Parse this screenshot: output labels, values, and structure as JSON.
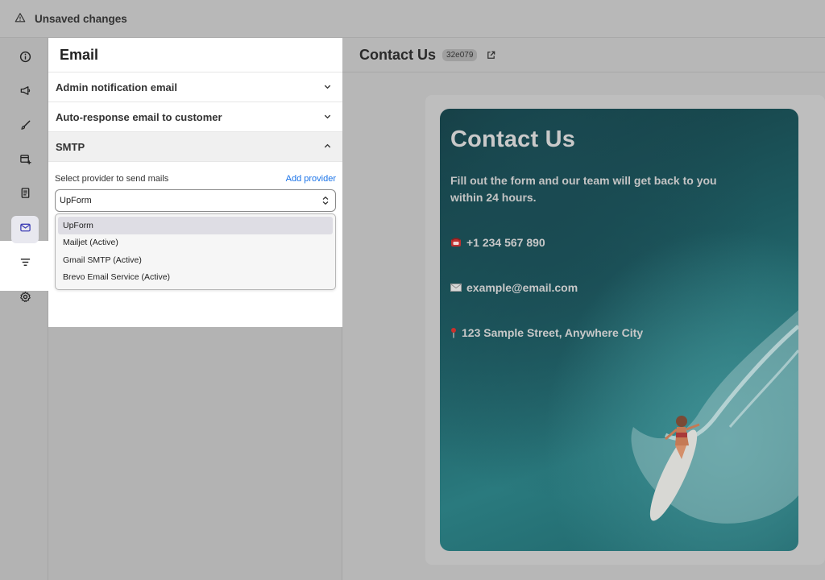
{
  "topbar": {
    "label": "Unsaved changes",
    "icon": "warning-triangle-icon"
  },
  "rail": {
    "items": [
      {
        "icon": "info-icon"
      },
      {
        "icon": "megaphone-icon"
      },
      {
        "icon": "paintbrush-icon"
      },
      {
        "icon": "add-window-icon"
      },
      {
        "icon": "receipt-icon"
      },
      {
        "icon": "mail-icon",
        "active": true
      },
      {
        "icon": "filter-icon"
      },
      {
        "icon": "gear-icon"
      }
    ]
  },
  "panel": {
    "title": "Email",
    "sections": [
      {
        "label": "Admin notification email",
        "expanded": false
      },
      {
        "label": "Auto-response email to customer",
        "expanded": false
      },
      {
        "label": "SMTP",
        "expanded": true
      }
    ],
    "smtp": {
      "provider_label": "Select provider to send mails",
      "add_provider": "Add provider",
      "selected": "UpForm",
      "options": [
        "UpForm",
        "Mailjet (Active)",
        "Gmail SMTP (Active)",
        "Brevo Email Service (Active)"
      ]
    }
  },
  "main": {
    "title": "Contact Us",
    "id_badge": "32e079"
  },
  "preview": {
    "heading": "Contact Us",
    "intro": "Fill out the form and our team will get back to you within 24 hours.",
    "phone": "+1 234 567 890",
    "email": "example@email.com",
    "address": "123 Sample Street, Anywhere City"
  },
  "colors": {
    "link": "#1a73e8",
    "overlay_gray": "#b7b7b7",
    "hero_teal": "#1d5a60"
  }
}
